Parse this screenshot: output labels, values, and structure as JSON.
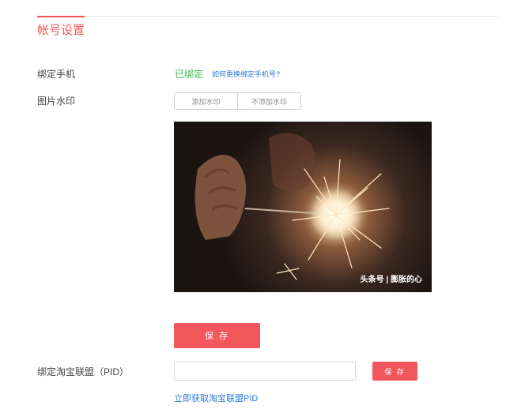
{
  "tab": {
    "title": "帐号设置"
  },
  "phone": {
    "label": "绑定手机",
    "status": "已绑定",
    "help_link": "如何更换绑定手机号?"
  },
  "watermark": {
    "label": "图片水印",
    "options": [
      "添加水印",
      "不添加水印"
    ],
    "preview_text": "头条号 | 膨胀的心"
  },
  "save_label": "保 存",
  "pid": {
    "label": "绑定淘宝联盟（PID）",
    "input_value": "",
    "input_placeholder": "",
    "save_label": "保 存",
    "get_link": "立即获取淘宝联盟PID"
  },
  "colors": {
    "accent": "#f2575e",
    "link": "#2b7ad6",
    "success": "#3bb84b"
  }
}
